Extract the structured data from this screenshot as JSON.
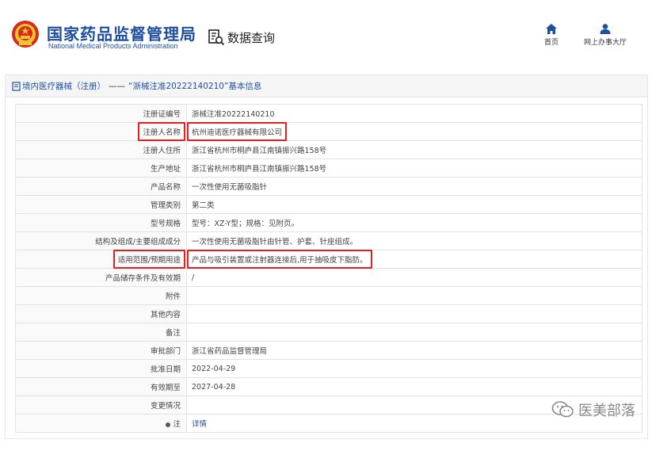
{
  "header": {
    "title_cn": "国家药品监督管理局",
    "title_en": "National Medical Products Administration",
    "query_label": "数据查询",
    "nav": [
      {
        "label": "首页",
        "icon": "home-icon"
      },
      {
        "label": "网上办事大厅",
        "icon": "user-icon"
      }
    ]
  },
  "breadcrumb": {
    "category": "境内医疗器械（注册）",
    "separator": "——",
    "title": "“浙械注准20222140210”基本信息"
  },
  "rows": [
    {
      "label": "注册证编号",
      "value": "浙械注准20222140210"
    },
    {
      "label": "注册人名称",
      "value": "杭州迪诺医疗器械有限公司"
    },
    {
      "label": "注册人住所",
      "value": "浙江省杭州市桐庐县江南镇振兴路158号"
    },
    {
      "label": "生产地址",
      "value": "浙江省杭州市桐庐县江南镇振兴路158号"
    },
    {
      "label": "产品名称",
      "value": "一次性使用无菌吸脂针"
    },
    {
      "label": "管理类别",
      "value": "第二类"
    },
    {
      "label": "型号规格",
      "value": "型号：XZ-Y型；规格：见附页。"
    },
    {
      "label": "结构及组成/主要组成成分",
      "value": "一次性使用无菌吸脂针由针管、护套、针座组成。"
    },
    {
      "label": "适用范围/预期用途",
      "value": "产品与吸引装置或注射器连接后,用于抽吸皮下脂肪。"
    },
    {
      "label": "产品储存条件及有效期",
      "value": "/"
    },
    {
      "label": "附件",
      "value": ""
    },
    {
      "label": "其他内容",
      "value": ""
    },
    {
      "label": "备注",
      "value": ""
    },
    {
      "label": "审批部门",
      "value": "浙江省药品监督管理局"
    },
    {
      "label": "批准日期",
      "value": "2022-04-29"
    },
    {
      "label": "有效期至",
      "value": "2027-04-28"
    },
    {
      "label": "变更情况",
      "value": ""
    },
    {
      "label": "注",
      "value": "详情"
    }
  ],
  "watermark": "医美部落",
  "colors": {
    "brand": "#1d4f9e",
    "highlight": "#e02020"
  }
}
